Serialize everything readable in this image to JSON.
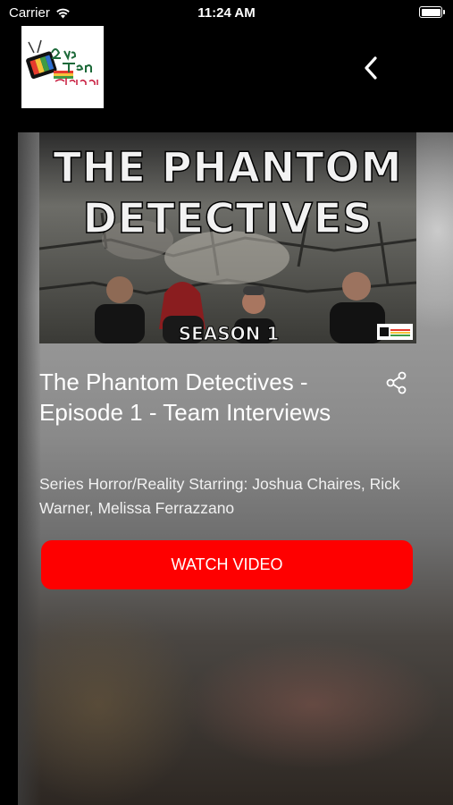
{
  "status_bar": {
    "carrier": "Carrier",
    "time": "11:24 AM"
  },
  "header": {
    "logo_icon": "2nd-team-entertainment-logo",
    "back_icon": "chevron-left-icon"
  },
  "episode": {
    "thumbnail": {
      "title_line1": "THE PHANTOM",
      "title_line2": "DETECTIVES",
      "season_label": "SEASON 1"
    },
    "title": "The Phantom Detectives - Episode 1 - Team Interviews",
    "share_icon": "share-icon",
    "description": "Series Horror/Reality Starring: Joshua Chaires, Rick Warner, Melissa Ferrazzano",
    "watch_button_label": "WATCH VIDEO"
  },
  "colors": {
    "accent": "#fe0000",
    "background": "#000000",
    "text": "#ffffff"
  }
}
